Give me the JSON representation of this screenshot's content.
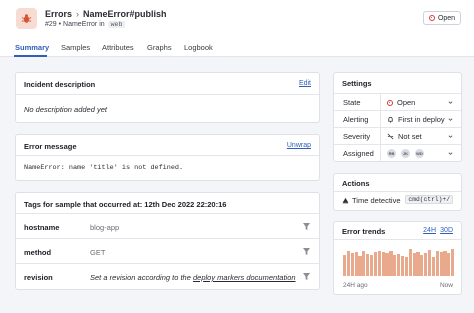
{
  "header": {
    "breadcrumb_root": "Errors",
    "breadcrumb_current": "NameError#publish",
    "subtitle_prefix": "#29 • NameError in",
    "namespace_tag": "web",
    "open_button_label": "Open"
  },
  "tabs": [
    {
      "label": "Summary",
      "active": true
    },
    {
      "label": "Samples"
    },
    {
      "label": "Attributes"
    },
    {
      "label": "Graphs"
    },
    {
      "label": "Logbook"
    }
  ],
  "incident": {
    "title": "Incident description",
    "edit_label": "Edit",
    "empty_text": "No description added yet"
  },
  "error_message": {
    "title": "Error message",
    "unwrap_label": "Unwrap",
    "text": "NameError: name 'title' is not defined."
  },
  "tags": {
    "title": "Tags for sample that occurred at: 12th Dec 2022 22:20:16",
    "rows": [
      {
        "key": "hostname",
        "value": "blog-app"
      },
      {
        "key": "method",
        "value": "GET"
      },
      {
        "key": "revision",
        "value_prefix": "Set a revision according to the ",
        "value_link": "deploy markers documentation"
      }
    ]
  },
  "settings": {
    "title": "Settings",
    "rows": [
      {
        "label": "State",
        "value": "Open",
        "icon": "open-circle-icon"
      },
      {
        "label": "Alerting",
        "value": "First in deploy",
        "icon": "bell-icon"
      },
      {
        "label": "Severity",
        "value": "Not set",
        "icon": "severity-slash-icon"
      },
      {
        "label": "Assigned",
        "avatars": [
          "RB",
          "JK",
          "WD"
        ]
      }
    ]
  },
  "actions": {
    "title": "Actions",
    "time_detective_label": "Time detective",
    "shortcut": "cmd(ctrl)+/"
  },
  "error_trends": {
    "title": "Error trends",
    "range_24h": "24H",
    "range_30d": "30D",
    "axis_start": "24H ago",
    "axis_end": "Now"
  },
  "chart_data": {
    "type": "bar",
    "values": [
      20,
      24,
      22,
      23,
      19,
      24,
      21,
      20,
      23,
      24,
      23,
      22,
      24,
      20,
      21,
      19,
      18,
      26,
      22,
      23,
      20,
      22,
      25,
      18,
      24,
      23,
      24,
      22,
      26
    ],
    "xlabel": "",
    "ylabel": ""
  },
  "colors": {
    "accent": "#2f5fb8",
    "danger": "#d63a3a",
    "bar": "#e8a98c",
    "logo_bg": "#f7dcd4"
  }
}
